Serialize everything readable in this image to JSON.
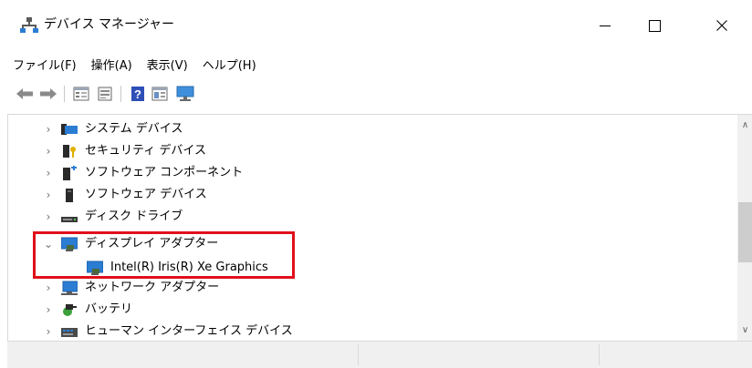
{
  "window": {
    "title": "デバイス マネージャー",
    "icon": "device-manager-icon"
  },
  "controls": {
    "minimize": "—",
    "close": "✕"
  },
  "menu": [
    {
      "label": "ファイル(F)"
    },
    {
      "label": "操作(A)"
    },
    {
      "label": "表示(V)"
    },
    {
      "label": "ヘルプ(H)"
    }
  ],
  "toolbar": [
    "back-arrow-icon",
    "forward-arrow-icon",
    "properties-icon",
    "update-driver-icon",
    "help-icon",
    "view-icon",
    "scan-hardware-icon"
  ],
  "tree": [
    {
      "label": "システム デバイス",
      "expanded": false,
      "icon": "system-devices-icon"
    },
    {
      "label": "セキュリティ デバイス",
      "expanded": false,
      "icon": "security-devices-icon"
    },
    {
      "label": "ソフトウェア コンポーネント",
      "expanded": false,
      "icon": "software-components-icon"
    },
    {
      "label": "ソフトウェア デバイス",
      "expanded": false,
      "icon": "software-devices-icon"
    },
    {
      "label": "ディスク ドライブ",
      "expanded": false,
      "icon": "disk-drive-icon"
    },
    {
      "label": "ディスプレイ アダプター",
      "expanded": true,
      "icon": "display-adapter-icon",
      "children": [
        {
          "label": "Intel(R) Iris(R) Xe Graphics",
          "icon": "display-adapter-icon"
        }
      ]
    },
    {
      "label": "ネットワーク アダプター",
      "expanded": false,
      "icon": "network-adapter-icon"
    },
    {
      "label": "バッテリ",
      "expanded": false,
      "icon": "battery-icon"
    },
    {
      "label": "ヒューマン インターフェイス デバイス",
      "expanded": false,
      "icon": "hid-icon"
    }
  ],
  "chevrons": {
    "collapsed": "›",
    "expanded": "⌄"
  },
  "colors": {
    "highlight": "#e0101a",
    "monitor": "#2b7cd3"
  }
}
